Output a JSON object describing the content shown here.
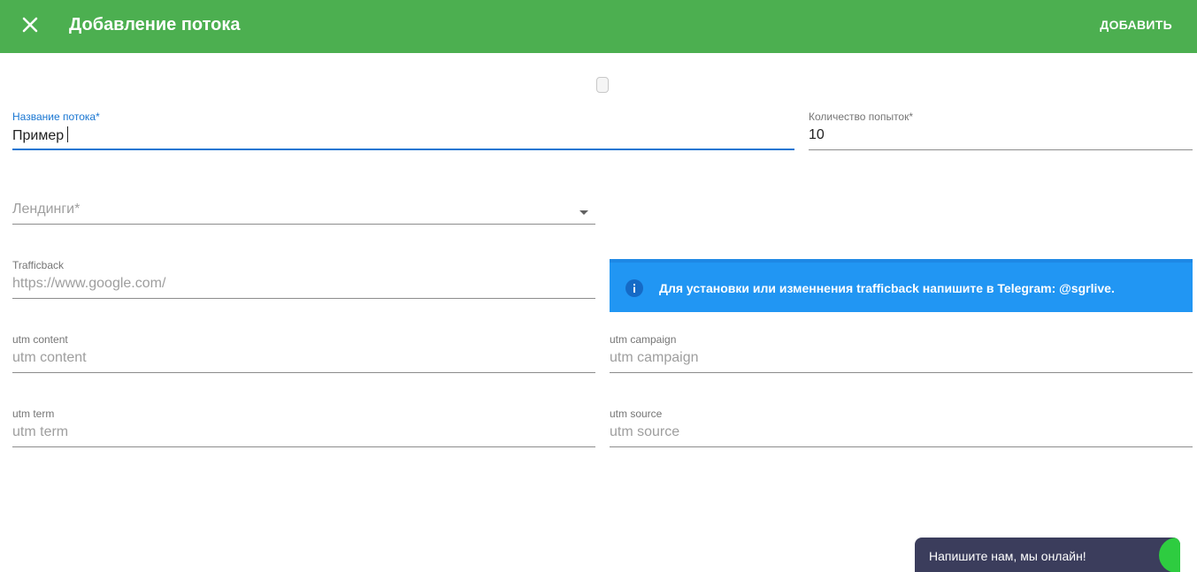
{
  "header": {
    "title": "Добавление потока",
    "add_label": "ДОБАВИТЬ",
    "bg_color": "#4caf50"
  },
  "form": {
    "stream_name": {
      "label": "Название потока*",
      "value": "Пример"
    },
    "attempts": {
      "label": "Количество попыток*",
      "value": "10"
    },
    "landings": {
      "placeholder": "Лендинги*"
    },
    "trafficback": {
      "label": "Trafficback",
      "placeholder": "https://www.google.com/"
    },
    "utm_content": {
      "label": "utm content",
      "placeholder": "utm content"
    },
    "utm_campaign": {
      "label": "utm campaign",
      "placeholder": "utm campaign"
    },
    "utm_term": {
      "label": "utm term",
      "placeholder": "utm term"
    },
    "utm_source": {
      "label": "utm source",
      "placeholder": "utm source"
    }
  },
  "info_alert": {
    "text": "Для установки или изменнения trafficback напишите в Telegram:",
    "handle": "@sgrlive.",
    "icon": "info-icon",
    "bg_color": "#2196f3"
  },
  "chat_widget": {
    "text": "Напишите нам, мы онлайн!",
    "status_color": "#2ecc40"
  }
}
